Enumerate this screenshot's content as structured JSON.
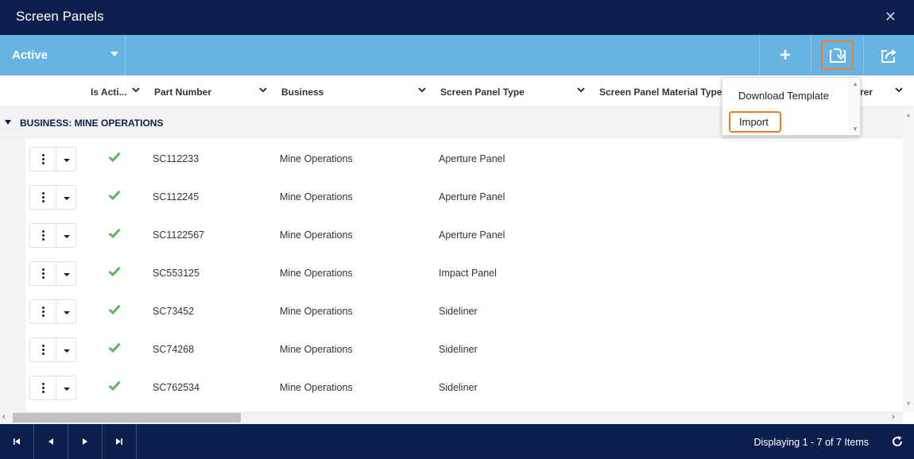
{
  "window": {
    "title": "Screen Panels",
    "close_glyph": "✕"
  },
  "toolbar": {
    "filter_label": "Active",
    "add_glyph": "+"
  },
  "columns": [
    {
      "label": "Is Acti..."
    },
    {
      "label": "Part Number"
    },
    {
      "label": "Business"
    },
    {
      "label": "Screen Panel Type"
    },
    {
      "label": "Screen Panel Material Type"
    },
    {
      "label": "rer"
    }
  ],
  "group": {
    "label": "BUSINESS: MINE OPERATIONS"
  },
  "rows": [
    {
      "is_active": true,
      "part_number": "SC112233",
      "business": "Mine Operations",
      "panel_type": "Aperture Panel"
    },
    {
      "is_active": true,
      "part_number": "SC112245",
      "business": "Mine Operations",
      "panel_type": "Aperture Panel"
    },
    {
      "is_active": true,
      "part_number": "SC1122567",
      "business": "Mine Operations",
      "panel_type": "Aperture Panel"
    },
    {
      "is_active": true,
      "part_number": "SC553125",
      "business": "Mine Operations",
      "panel_type": "Impact Panel"
    },
    {
      "is_active": true,
      "part_number": "SC73452",
      "business": "Mine Operations",
      "panel_type": "Sideliner"
    },
    {
      "is_active": true,
      "part_number": "SC74268",
      "business": "Mine Operations",
      "panel_type": "Sideliner"
    },
    {
      "is_active": true,
      "part_number": "SC762534",
      "business": "Mine Operations",
      "panel_type": "Sideliner"
    }
  ],
  "import_menu": {
    "items": [
      {
        "label": "Download Template"
      },
      {
        "label": "Import"
      }
    ]
  },
  "pager": {
    "info": "Displaying 1 - 7 of 7 Items"
  },
  "colors": {
    "navy": "#0c1f4d",
    "toolbar_blue": "#66b3e4",
    "highlight_orange": "#f07d2a",
    "check_green": "#5cb85c"
  }
}
